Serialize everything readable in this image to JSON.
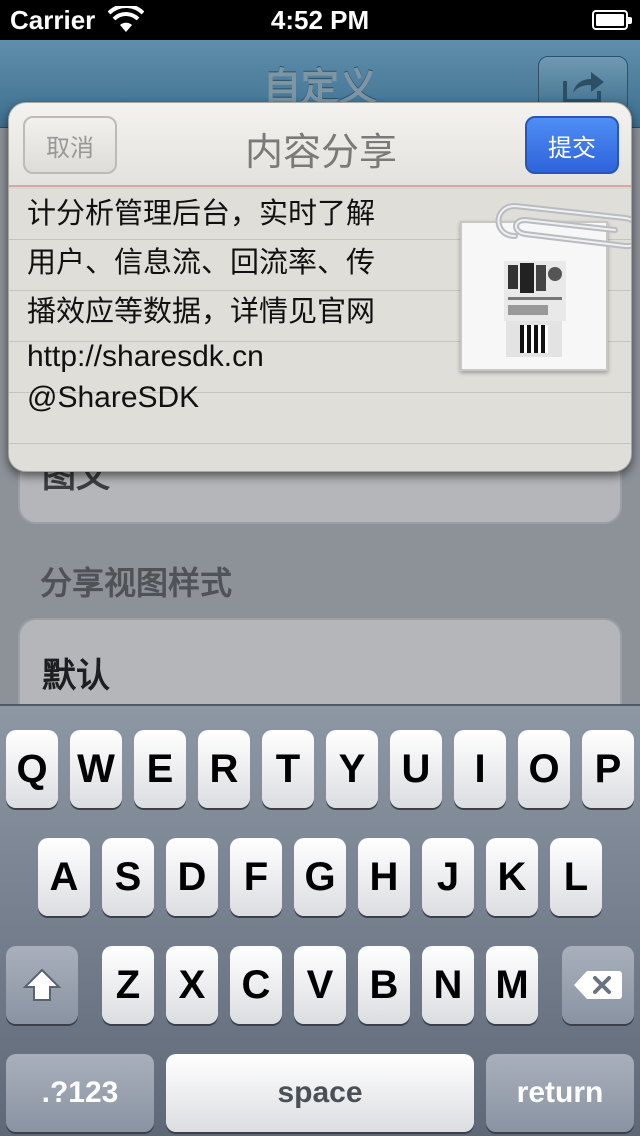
{
  "status_bar": {
    "carrier": "Carrier",
    "time": "4:52 PM"
  },
  "nav_bar": {
    "title": "自定义",
    "share_icon": "share-arrow-icon"
  },
  "background_form": {
    "field1_value": "图文",
    "section_label": "分享视图样式",
    "field2_value": "默认"
  },
  "share_card": {
    "cancel_label": "取消",
    "title": "内容分享",
    "submit_label": "提交",
    "message_lines": [
      "计分析管理后台，实时了解",
      "用户、信息流、回流率、传",
      "播效应等数据，详情见官网",
      "http://sharesdk.cn",
      "@ShareSDK"
    ],
    "attachment_icon": "paperclip-icon"
  },
  "keyboard": {
    "row1": [
      "Q",
      "W",
      "E",
      "R",
      "T",
      "Y",
      "U",
      "I",
      "O",
      "P"
    ],
    "row2": [
      "A",
      "S",
      "D",
      "F",
      "G",
      "H",
      "J",
      "K",
      "L"
    ],
    "row3": [
      "Z",
      "X",
      "C",
      "V",
      "B",
      "N",
      "M"
    ],
    "numbers_label": ".?123",
    "space_label": "space",
    "return_label": "return",
    "shift_icon": "shift-icon",
    "delete_icon": "backspace-icon"
  }
}
